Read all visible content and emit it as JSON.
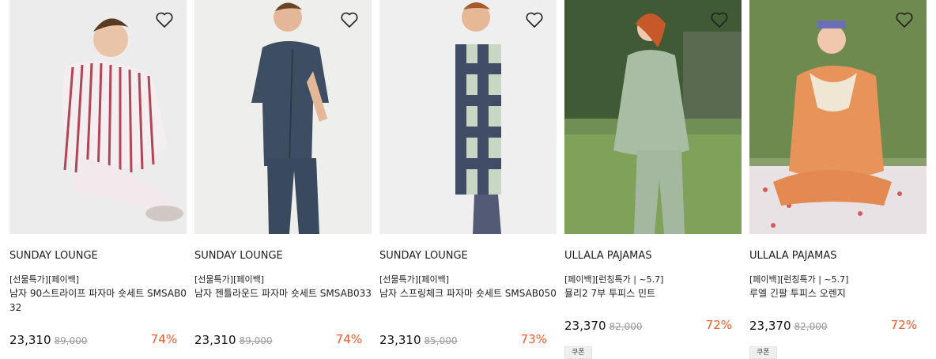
{
  "products": [
    {
      "brand": "SUNDAY LOUNGE",
      "tag": "[선물특가][페이백]",
      "name": "남자 90스트라이프 파자마 숏세트 SMSAB032",
      "price": "23,310",
      "original_price": "89,000",
      "discount": "74%",
      "coupon": null,
      "image_theme": "white-with-red-stripe-pajamas"
    },
    {
      "brand": "SUNDAY LOUNGE",
      "tag": "[선물특가][페이백]",
      "name": "남자 젠틀라운드 파자마 숏세트 SMSAB033",
      "price": "23,310",
      "original_price": "89,000",
      "discount": "74%",
      "coupon": null,
      "image_theme": "navy-pajamas"
    },
    {
      "brand": "SUNDAY LOUNGE",
      "tag": "[선물특가][페이백]",
      "name": "남자 스프링체크 파자마 숏세트 SMSAB050",
      "price": "23,310",
      "original_price": "85,000",
      "discount": "73%",
      "coupon": null,
      "image_theme": "blue-check-pajamas"
    },
    {
      "brand": "ULLALA PAJAMAS",
      "tag": "[페이백][런칭특가 | ~5.7]",
      "name": "뮬리2 7부 투피스 민트",
      "price": "23,370",
      "original_price": "82,000",
      "discount": "72%",
      "coupon": "쿠폰",
      "image_theme": "mint-two-piece-outdoor"
    },
    {
      "brand": "ULLALA PAJAMAS",
      "tag": "[페이백][런칭특가 | ~5.7]",
      "name": "루엘 긴팔 투피스 오렌지",
      "price": "23,370",
      "original_price": "82,000",
      "discount": "72%",
      "coupon": "쿠폰",
      "image_theme": "orange-two-piece-picnic"
    }
  ],
  "icons": {
    "wishlist": "heart-outline-icon"
  },
  "colors": {
    "discount": "#ef5a28",
    "strike": "#9a9a9a"
  }
}
